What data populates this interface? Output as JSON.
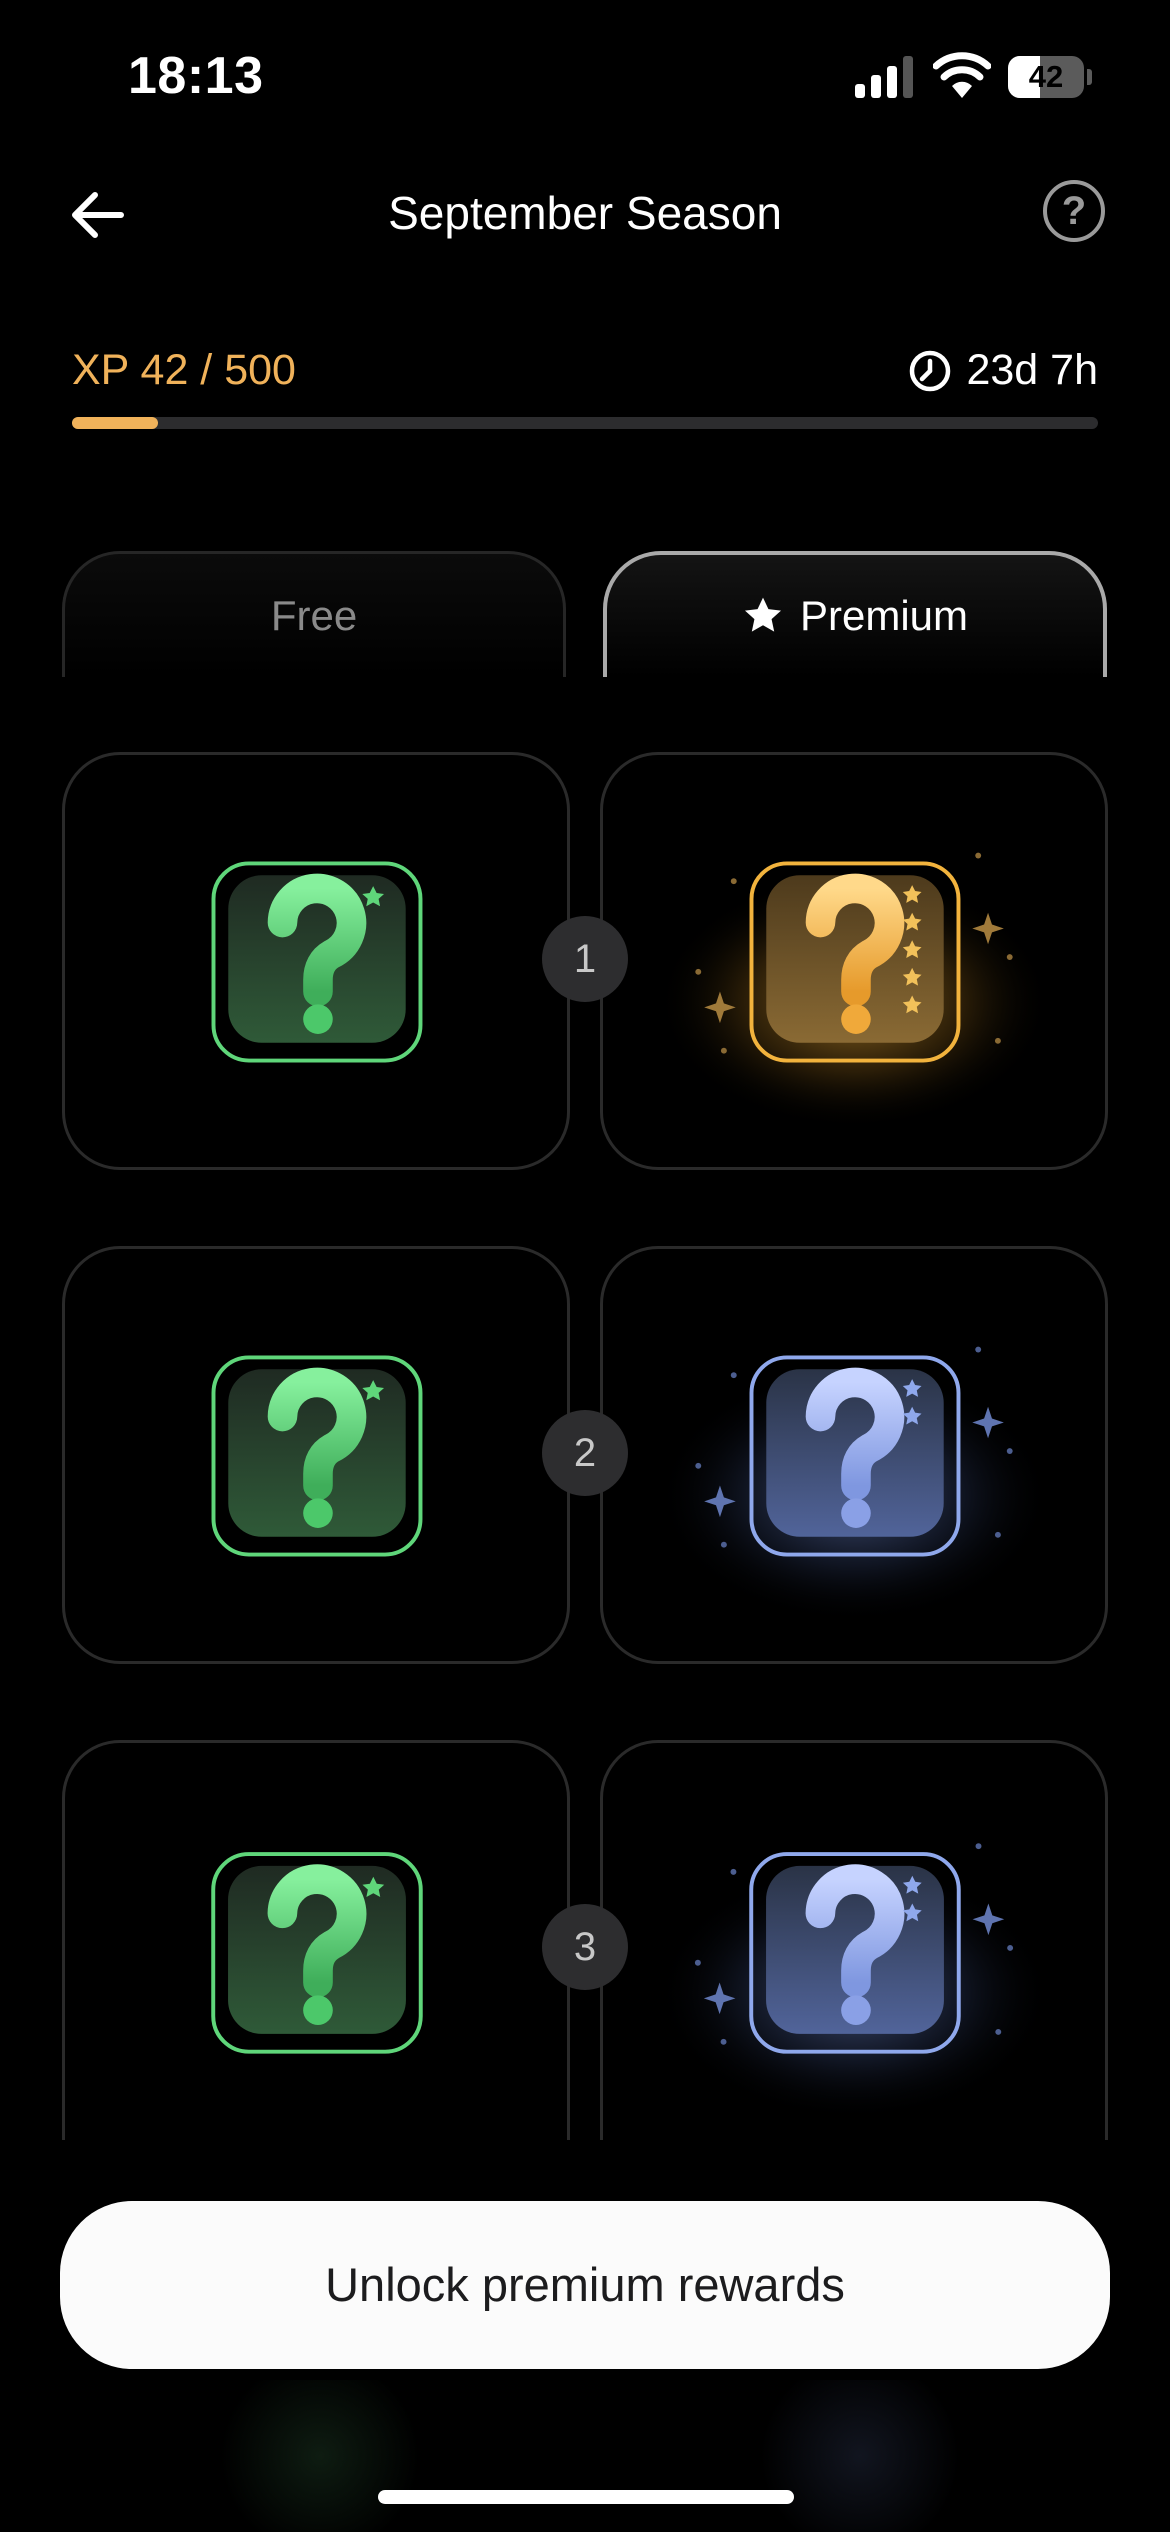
{
  "status_bar": {
    "time": "18:13",
    "battery": "42",
    "battery_level": 0.42
  },
  "header": {
    "title": "September Season",
    "back_icon": "arrow-left-icon",
    "help_icon": "question-circle-icon"
  },
  "progress": {
    "xp_text": "XP 42 / 500",
    "xp_fraction": 0.084,
    "time_left": "23d 7h",
    "accent_color": "#f0b25a"
  },
  "tabs": [
    {
      "label": "Free",
      "active": false
    },
    {
      "label": "Premium",
      "active": true,
      "icon": "star-icon"
    }
  ],
  "levels": [
    {
      "number": "1",
      "free_reward": "green-mystery-icon",
      "premium_reward": "gold-mystery-icon"
    },
    {
      "number": "2",
      "free_reward": "green-mystery-icon",
      "premium_reward": "blue-mystery-icon"
    },
    {
      "number": "3",
      "free_reward": "green-mystery-icon",
      "premium_reward": "blue-mystery-icon"
    }
  ],
  "cta": {
    "label": "Unlock premium rewards"
  },
  "colors": {
    "green": "#5fd67a",
    "gold": "#f2b33d",
    "blue": "#8fa8ec"
  }
}
